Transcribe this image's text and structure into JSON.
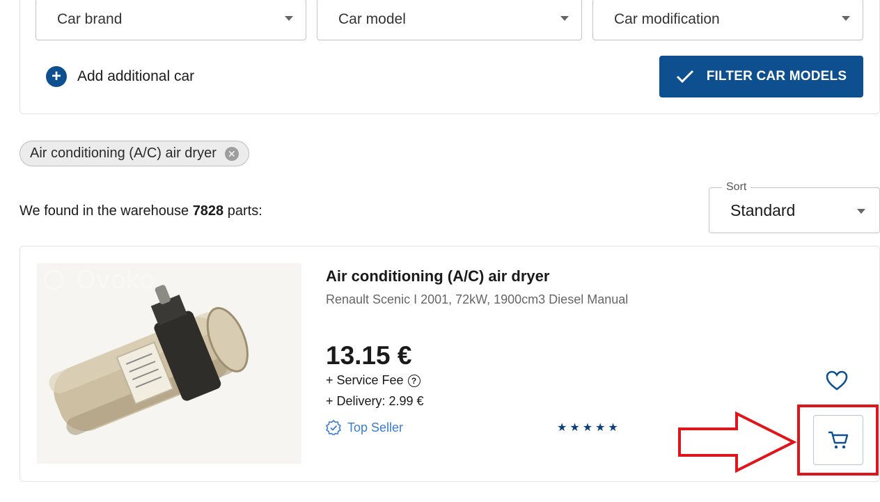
{
  "filters": {
    "brand_placeholder": "Car brand",
    "model_placeholder": "Car model",
    "modification_placeholder": "Car modification",
    "add_car_label": "Add additional car",
    "filter_button_label": "FILTER CAR MODELS"
  },
  "active_chip": {
    "label": "Air conditioning (A/C) air dryer"
  },
  "results": {
    "prefix": "We found in the warehouse ",
    "count": "7828",
    "suffix": " parts:"
  },
  "sort": {
    "legend": "Sort",
    "value": "Standard"
  },
  "product": {
    "title": "Air conditioning (A/C) air dryer",
    "subtitle": "Renault Scenic I 2001, 72kW, 1900cm3 Diesel Manual",
    "price": "13.15 €",
    "service_fee": "+ Service Fee",
    "delivery": "+ Delivery: 2.99 €",
    "seller_badge": "Top Seller",
    "rating_stars": 5,
    "watermark": "Ovoko"
  },
  "colors": {
    "primary": "#0d4f8f",
    "accent_link": "#3a7bd5",
    "annotation": "#e0151b"
  },
  "icons": [
    "chevron-down-icon",
    "plus-circle-icon",
    "checkmark-icon",
    "close-circle-icon",
    "question-circle-icon",
    "verified-badge-icon",
    "star-icon",
    "heart-icon",
    "cart-icon"
  ]
}
